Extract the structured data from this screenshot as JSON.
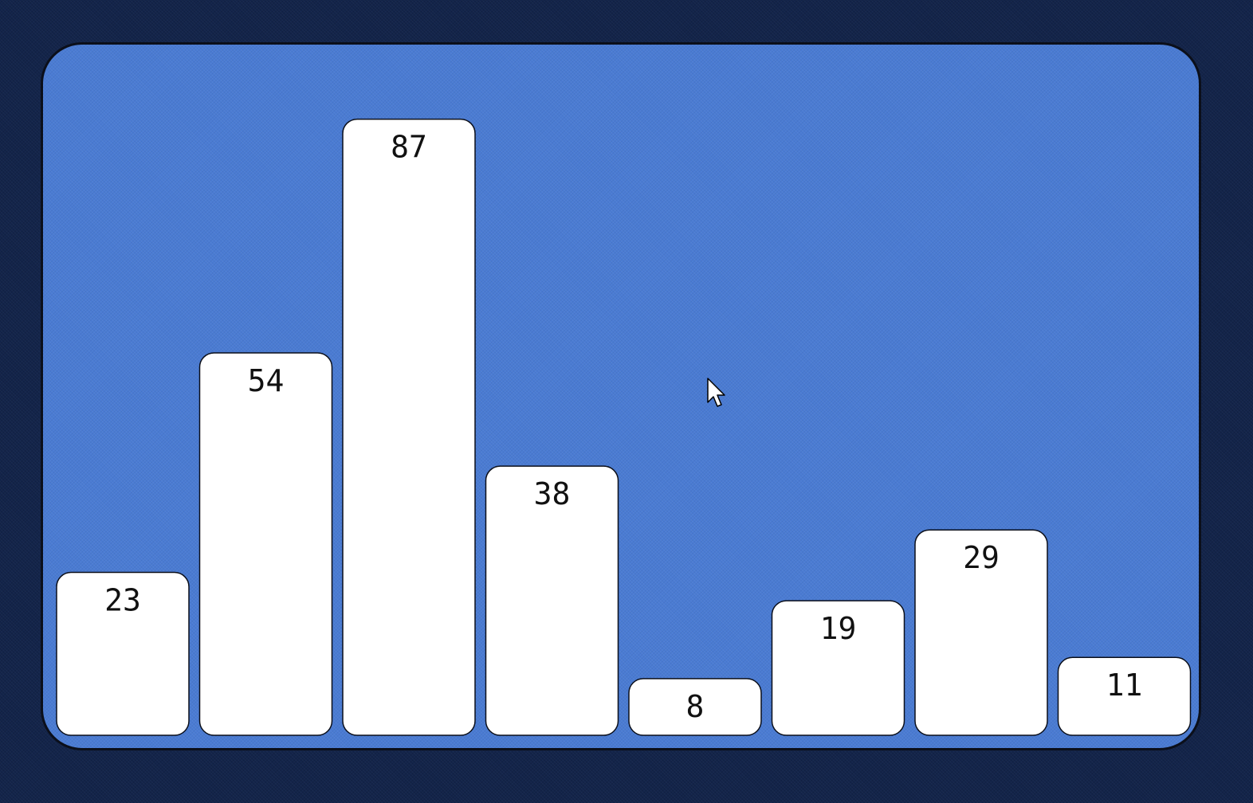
{
  "chart_data": {
    "type": "bar",
    "categories": [
      "",
      "",
      "",
      "",
      "",
      "",
      "",
      ""
    ],
    "values": [
      23,
      54,
      87,
      38,
      8,
      19,
      29,
      11
    ],
    "title": "",
    "xlabel": "",
    "ylabel": "",
    "ylim": [
      0,
      87
    ],
    "grid": false,
    "legend": "none",
    "data_labels": "inside-top"
  },
  "colors": {
    "page_background": "#13244a",
    "panel_background": "#4a7bd3",
    "bar_fill": "#ffffff",
    "bar_outline": "#0b0f1a",
    "label_text": "#111111"
  },
  "pointer": {
    "icon": "mouse-pointer-icon"
  }
}
